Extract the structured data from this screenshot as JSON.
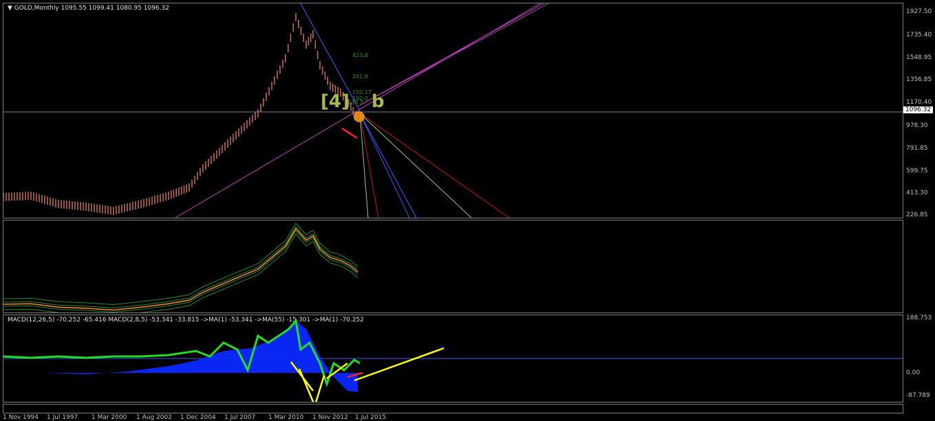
{
  "main_pane": {
    "title": "GOLD,Monthly  1095.55 1099.41 1080.95 1096.32",
    "price_label": "1096.32",
    "y_ticks": [
      "1927.50",
      "1735.40",
      "1548.95",
      "1356.85",
      "1170.40",
      "978.30",
      "791.85",
      "599.75",
      "413.30",
      "226.85"
    ],
    "fibo_levels": [
      "423.6",
      "261.8",
      "150.17",
      "138.2",
      "100.0"
    ],
    "wave_labels": {
      "left": "[4]",
      "right": "b"
    }
  },
  "macd_pane": {
    "title": "MACD(12,26,5) -70.252 -65.416  MACD(2,8,5) -53.341 -33.815  ->MA(1) -53.341  ->MA(55) -15.301  ->MA(1) -70.252",
    "y_ticks": [
      "188.753",
      "0.00",
      "-87.789"
    ]
  },
  "x_axis": {
    "labels": [
      "1 Nov 1994",
      "1 Jul 1997",
      "1 Mar 2000",
      "1 Aug 2002",
      "1 Dec 2004",
      "1 Jul 2007",
      "1 Mar 2010",
      "1 Nov 2012",
      "1 Jul 2015"
    ]
  },
  "colors": {
    "candles": "#c8705a",
    "fan_blue": "#3a5bff",
    "fan_red": "#d01010",
    "fan_green": "#7fd0a0",
    "channel_magenta": "#c040c0",
    "macd_hist": "#0a28ff",
    "macd_line": "#20e020",
    "arrows": "#ffff00",
    "envelope": "#1f8f1f",
    "price_line_orange": "#ff8c1a"
  }
}
